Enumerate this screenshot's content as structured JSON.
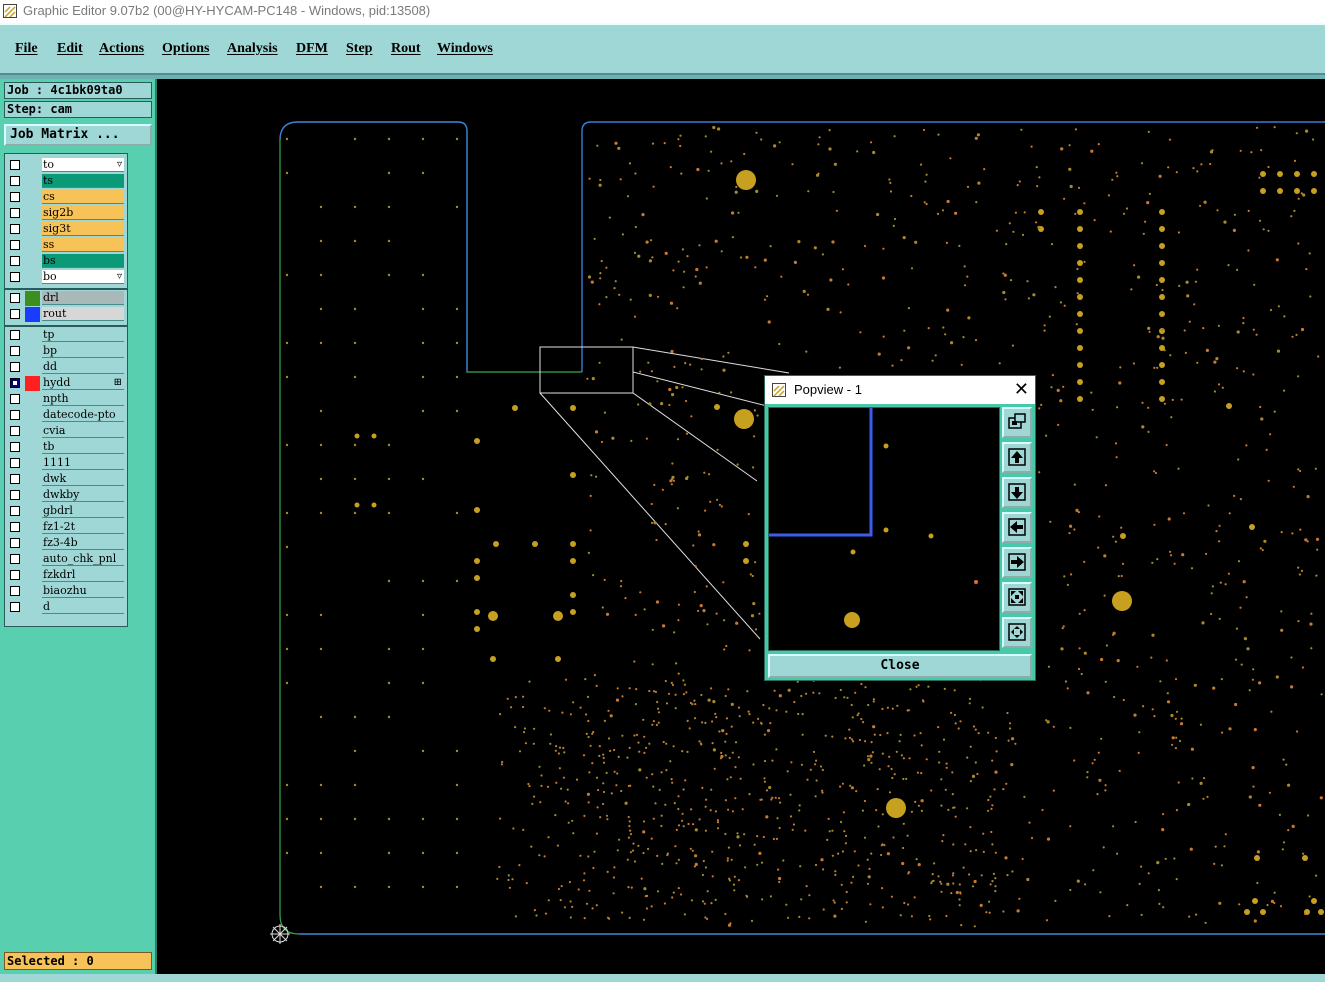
{
  "window": {
    "title": "Graphic Editor 9.07b2 (00@HY-HYCAM-PC148 - Windows, pid:13508)"
  },
  "menu": [
    "File",
    "Edit",
    "Actions",
    "Options",
    "Analysis",
    "DFM",
    "Step",
    "Rout",
    "Windows"
  ],
  "job": {
    "job_label": "Job : 4c1bk09ta0",
    "step_label": "Step: cam",
    "matrix_button": "Job Matrix ..."
  },
  "layers": {
    "board": [
      {
        "name": "to",
        "color": "#ffffff",
        "has_menu": true
      },
      {
        "name": "ts",
        "color": "#0a9a78"
      },
      {
        "name": "cs",
        "color": "#f7c257"
      },
      {
        "name": "sig2b",
        "color": "#f7c257"
      },
      {
        "name": "sig3t",
        "color": "#f7c257"
      },
      {
        "name": "ss",
        "color": "#f7c257"
      },
      {
        "name": "bs",
        "color": "#0a9a78"
      },
      {
        "name": "bo",
        "color": "#ffffff",
        "has_menu": true
      }
    ],
    "drill": [
      {
        "name": "drl",
        "color": "#a9b9b9",
        "swatch": "#3e8e1e"
      },
      {
        "name": "rout",
        "color": "#d7d7d7",
        "swatch": "#1a3cff"
      }
    ],
    "misc": [
      {
        "name": "tp"
      },
      {
        "name": "bp"
      },
      {
        "name": "dd"
      },
      {
        "name": "hydd",
        "swatch": "#ff2020",
        "checked": true,
        "has_menu": true
      },
      {
        "name": "npth"
      },
      {
        "name": "datecode-pto"
      },
      {
        "name": "cvia"
      },
      {
        "name": "tb"
      },
      {
        "name": "1111"
      },
      {
        "name": "dwk"
      },
      {
        "name": "dwkby"
      },
      {
        "name": "gbdrl"
      },
      {
        "name": "fz1-2t"
      },
      {
        "name": "fz3-4b"
      },
      {
        "name": "auto_chk_pnl"
      },
      {
        "name": "fzkdrl"
      },
      {
        "name": "biaozhu"
      },
      {
        "name": "d"
      }
    ]
  },
  "status": {
    "selected": "Selected : 0"
  },
  "popview": {
    "title": "Popview - 1",
    "close_label": "Close"
  },
  "colors": {
    "menubar": "#9fd7d7",
    "panel": "#58d0b0",
    "pad": "#c8a020",
    "outline_blue": "#3a7bd5",
    "outline_green": "#3aa84a"
  }
}
